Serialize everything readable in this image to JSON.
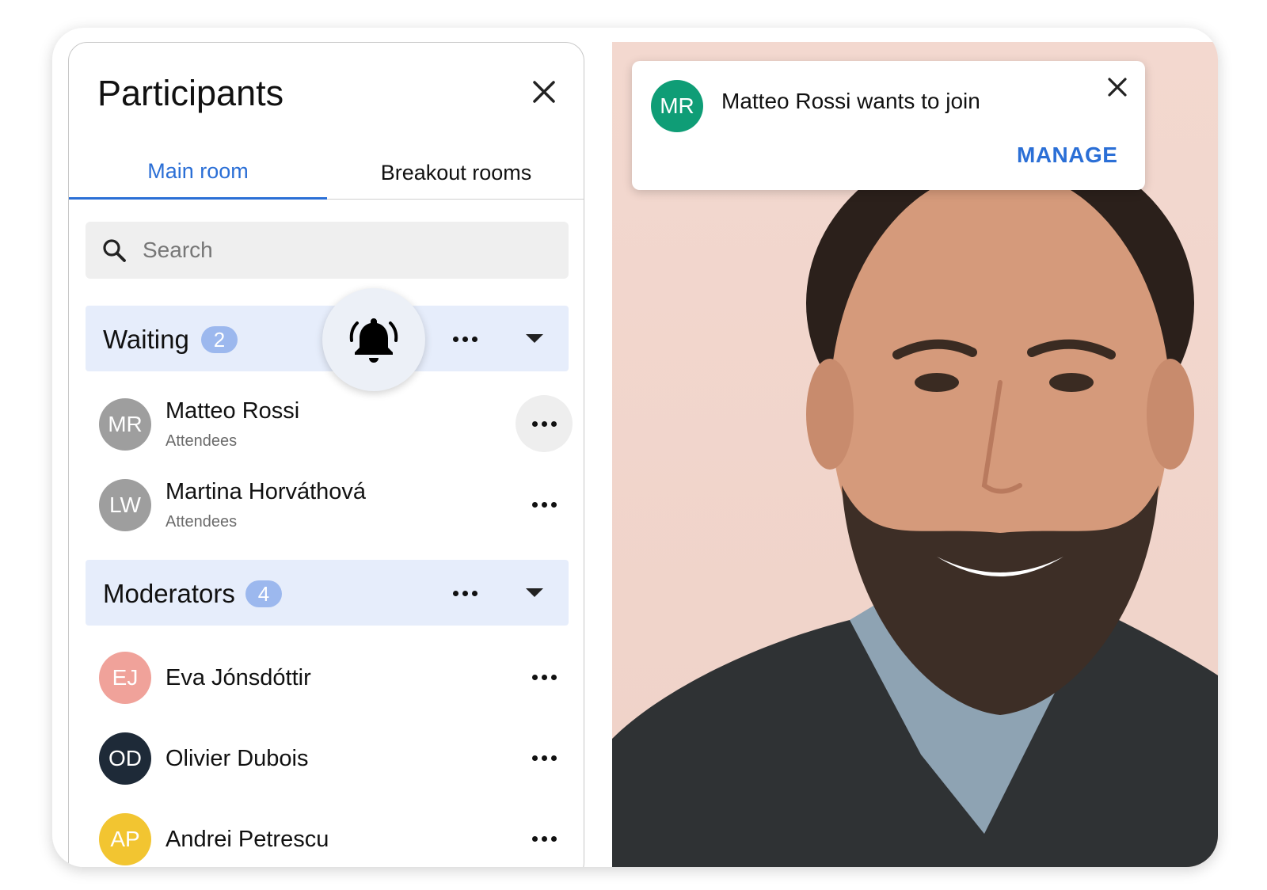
{
  "panel": {
    "title": "Participants",
    "tabs": [
      {
        "label": "Main room",
        "active": true
      },
      {
        "label": "Breakout rooms",
        "active": false
      }
    ],
    "search": {
      "placeholder": "Search"
    }
  },
  "groups": {
    "waiting": {
      "label": "Waiting",
      "count": "2",
      "members": [
        {
          "initials": "MR",
          "name": "Matteo Rossi",
          "role": "Attendees",
          "avatar_color": "#9e9e9e"
        },
        {
          "initials": "LW",
          "name": "Martina Horváthová",
          "role": "Attendees",
          "avatar_color": "#9e9e9e"
        }
      ]
    },
    "moderators": {
      "label": "Moderators",
      "count": "4",
      "members": [
        {
          "initials": "EJ",
          "name": "Eva Jónsdóttir",
          "avatar_color": "#f0a29a"
        },
        {
          "initials": "OD",
          "name": "Olivier Dubois",
          "avatar_color": "#1e2a38"
        },
        {
          "initials": "AP",
          "name": "Andrei Petrescu",
          "avatar_color": "#f2c531"
        }
      ]
    }
  },
  "notification": {
    "initials": "MR",
    "message": "Matteo Rossi wants to join",
    "action": "MANAGE",
    "avatar_color": "#0f9d76"
  },
  "colors": {
    "accent": "#2b6fd6",
    "group_header_bg": "#e6edfb",
    "badge_bg": "#9cb8ee",
    "video_bg": "#f3d8cf"
  }
}
